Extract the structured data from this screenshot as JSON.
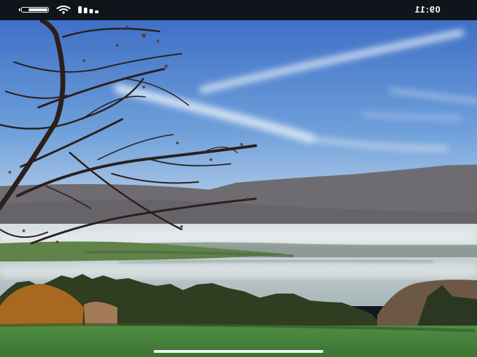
{
  "status": {
    "time": "09:11",
    "battery_level": 0.78,
    "wifi_icon": "wifi-icon",
    "signal_icon": "cellular-signal-icon",
    "battery_icon": "battery-icon"
  },
  "content": {
    "type": "fullscreen-photo",
    "subject": "landscape"
  }
}
